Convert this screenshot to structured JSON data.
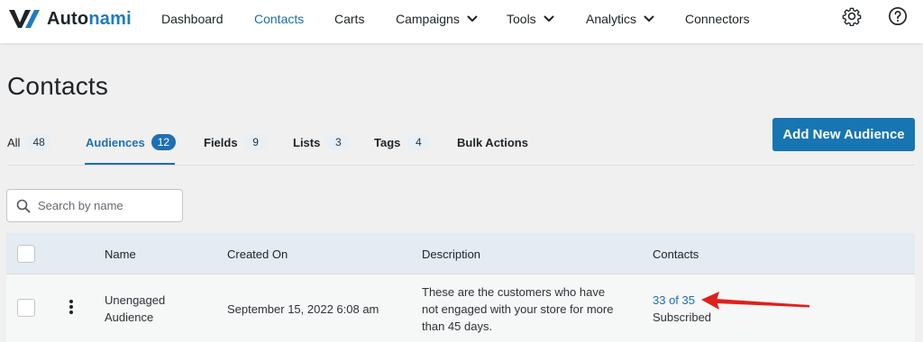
{
  "app": {
    "logo_text_1": "Auto",
    "logo_text_2": "nami",
    "brand_color": "#1e7cc0"
  },
  "nav": {
    "items": [
      {
        "label": "Dashboard"
      },
      {
        "label": "Contacts",
        "active": true
      },
      {
        "label": "Carts"
      },
      {
        "label": "Campaigns",
        "has_dropdown": true
      },
      {
        "label": "Tools",
        "has_dropdown": true
      },
      {
        "label": "Analytics",
        "has_dropdown": true
      },
      {
        "label": "Connectors"
      }
    ],
    "icons": [
      "gear-icon",
      "help-icon"
    ]
  },
  "page": {
    "title": "Contacts"
  },
  "tabs": [
    {
      "label": "All",
      "count": "48"
    },
    {
      "label": "Audiences",
      "count": "12",
      "active": true
    },
    {
      "label": "Fields",
      "count": "9"
    },
    {
      "label": "Lists",
      "count": "3"
    },
    {
      "label": "Tags",
      "count": "4"
    },
    {
      "label": "Bulk Actions"
    }
  ],
  "actions": {
    "add_audience_label": "Add New Audience"
  },
  "search": {
    "placeholder": "Search by name",
    "value": ""
  },
  "table": {
    "columns": [
      "Name",
      "Created On",
      "Description",
      "Contacts"
    ],
    "rows": [
      {
        "name_line1": "Unengaged",
        "name_line2": "Audience",
        "created_on": "September 15, 2022 6:08 am",
        "description_line1": "These are the customers who have",
        "description_line2": "not engaged with your store for more",
        "description_line3": "than 45 days.",
        "contacts_count": "33 of 35",
        "contacts_status": "Subscribed"
      }
    ]
  },
  "colors": {
    "accent": "#1e6fb4",
    "button": "#1775b2",
    "annotation_arrow": "#e0201b"
  }
}
